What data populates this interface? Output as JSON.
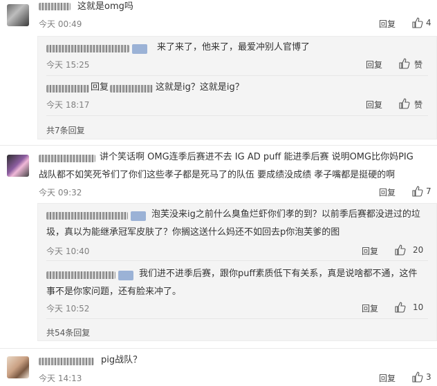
{
  "comments": [
    {
      "text": "这就是omg吗",
      "time": "今天 00:49",
      "reply_label": "回复",
      "likes": "4",
      "replies": [
        {
          "text": "来了来了，他来了，最爱冲别人官博了",
          "time": "今天 15:25",
          "reply_label": "回复",
          "likes": "赞"
        },
        {
          "prefix": "回复",
          "text": "这就是ig？这就是ig？",
          "time": "今天 18:17",
          "reply_label": "回复",
          "likes": "赞"
        }
      ],
      "more": "共7条回复"
    },
    {
      "text_line1": "讲个笑话啊   OMG连季后赛进不去    IG AD puff 能进季后赛 说明OMG比你妈PIG",
      "text_line2": "战队都不如笑死爷们了你们这些孝子都是死马了的队伍 要成绩没成绩  孝子嘴都是挺硬的啊",
      "time": "今天 09:32",
      "reply_label": "回复",
      "likes": "7",
      "replies": [
        {
          "text_line1": "泡芙没来ig之前什么臭鱼烂虾你们孝的到？以前季后赛都没进过的垃",
          "text_line2": "圾，真以为能继承冠军皮肤了？你搁这送什么妈还不如回去p你泡芙爹的图",
          "time": "今天 10:40",
          "reply_label": "回复",
          "likes": "20"
        },
        {
          "text_line1": "我们进不进季后赛，跟你puff素质低下有关系，真是说啥都不通，这件",
          "text_line2": "事不是你家问题，还有脸来冲了。",
          "time": "今天 10:52",
          "reply_label": "回复",
          "likes": "10"
        }
      ],
      "more": "共54条回复"
    },
    {
      "text": "pig战队？",
      "time": "今天 14:13",
      "reply_label": "回复",
      "likes": "3"
    }
  ],
  "icons": {
    "like": "thumbs-up-icon"
  },
  "colors": {
    "sub_bg": "#f4f4f4",
    "meta": "#808080",
    "badge": "#9bb2d6"
  }
}
